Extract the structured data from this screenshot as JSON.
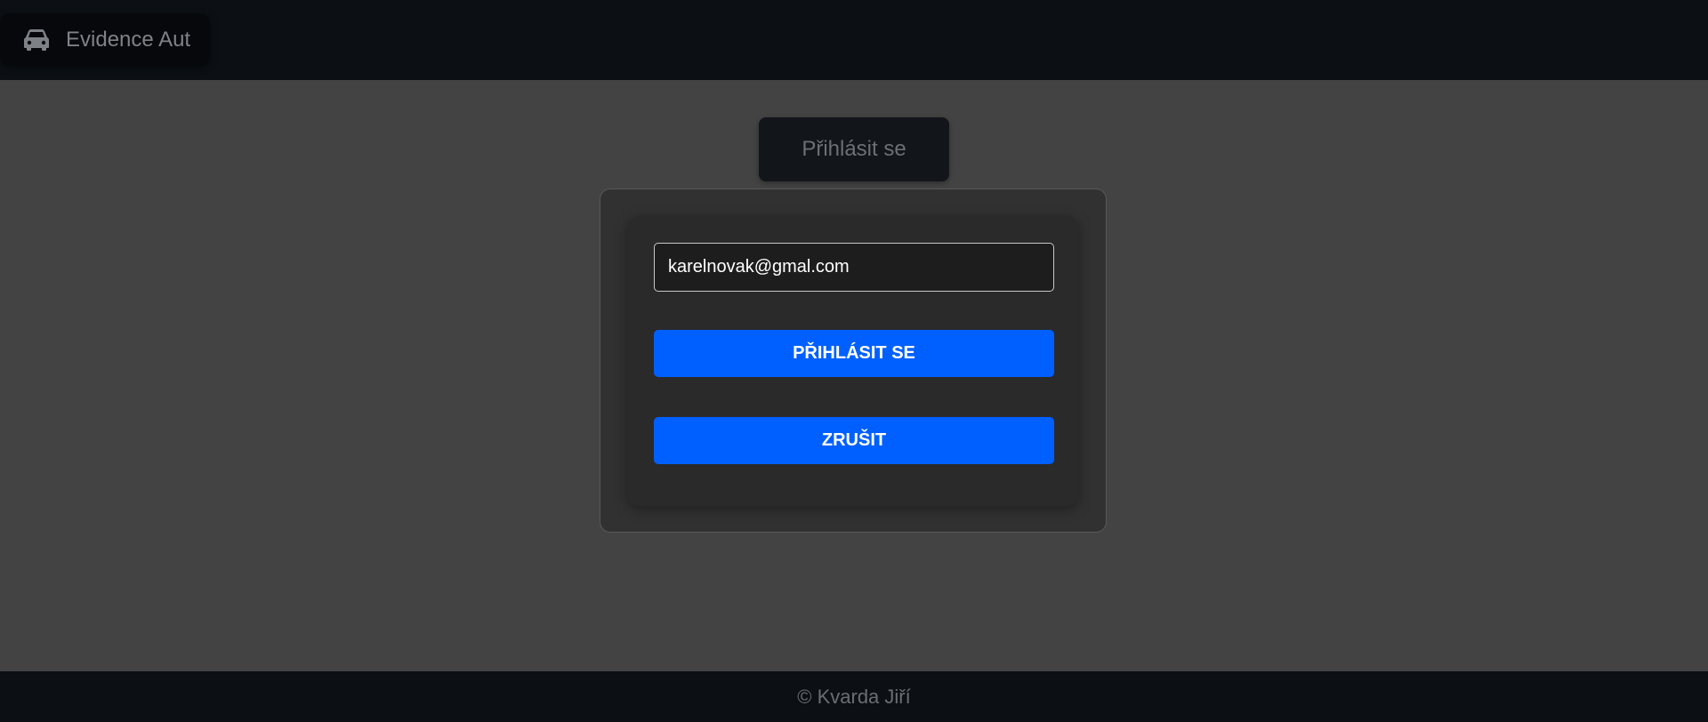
{
  "header": {
    "brand_icon": "car-icon",
    "brand_label": "Evidence Aut"
  },
  "main": {
    "heading": "Přihlásit se",
    "email_value": "karelnovak@gmal.com",
    "login_button": "PŘIHLÁSIT SE",
    "cancel_button": "ZRUŠIT"
  },
  "footer": {
    "copyright": "© Kvarda Jiří"
  },
  "colors": {
    "accent": "#0060ff",
    "header_bg": "#0c1015",
    "page_bg": "#434343"
  }
}
